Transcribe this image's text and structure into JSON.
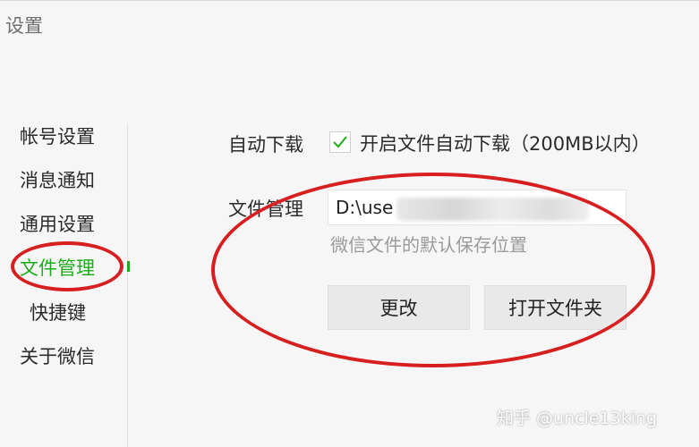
{
  "window": {
    "title": "设置"
  },
  "sidebar": {
    "items": [
      {
        "label": "帐号设置",
        "active": false
      },
      {
        "label": "消息通知",
        "active": false
      },
      {
        "label": "通用设置",
        "active": false
      },
      {
        "label": "文件管理",
        "active": true
      },
      {
        "label": "快捷键",
        "active": false
      },
      {
        "label": "关于微信",
        "active": false
      }
    ]
  },
  "main": {
    "auto_download": {
      "label": "自动下载",
      "checkbox_checked": true,
      "checkbox_label": "开启文件自动下载（200MB以内）"
    },
    "file_management": {
      "label": "文件管理",
      "path_value": "D:\\use",
      "hint": "微信文件的默认保存位置",
      "change_button": "更改",
      "open_folder_button": "打开文件夹"
    }
  },
  "colors": {
    "accent": "#1aad19",
    "annotation": "#d71f1f"
  },
  "watermark": "知乎 @uncle13king"
}
